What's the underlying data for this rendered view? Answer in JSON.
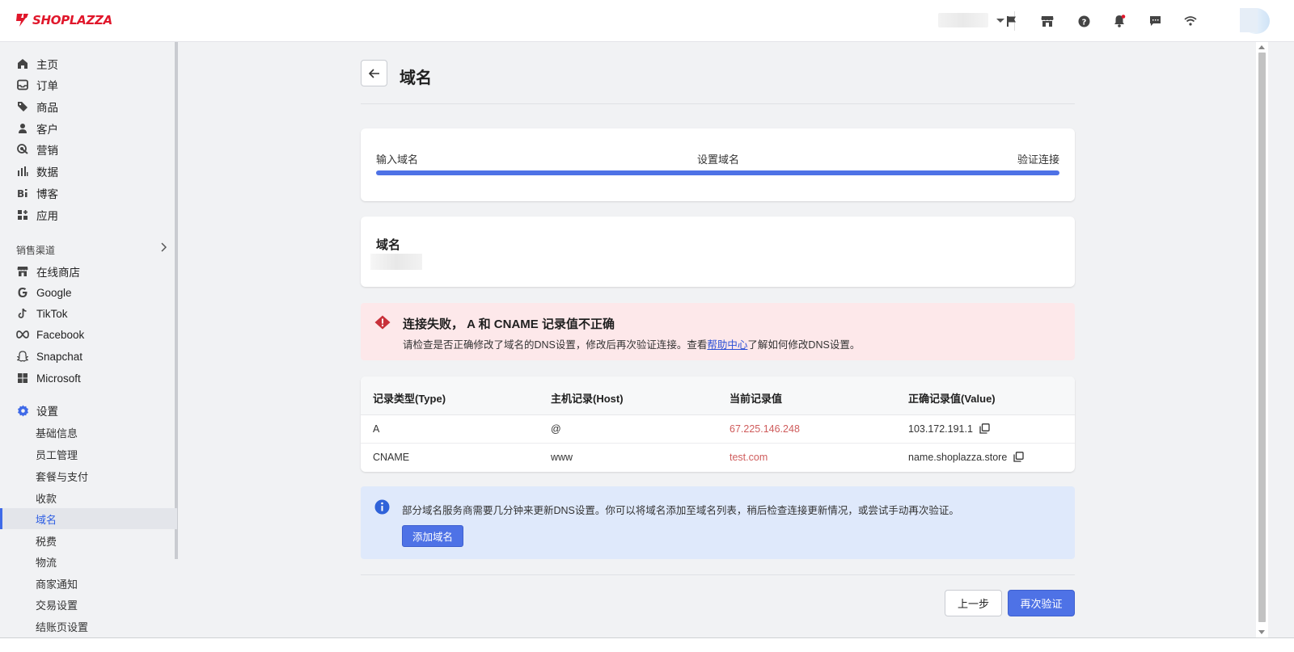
{
  "brand": {
    "name": "SHOPLAZZA",
    "color": "#e0172b",
    "accent": "#4e72e6"
  },
  "header": {
    "icons": [
      "flag-icon",
      "store-icon",
      "help-icon",
      "bell-icon",
      "message-icon",
      "wifi-icon"
    ]
  },
  "sidebar": {
    "main_items": [
      {
        "label": "主页",
        "icon": "home-icon"
      },
      {
        "label": "订单",
        "icon": "inbox-icon"
      },
      {
        "label": "商品",
        "icon": "tag-icon"
      },
      {
        "label": "客户",
        "icon": "person-icon"
      },
      {
        "label": "营销",
        "icon": "marketing-icon"
      },
      {
        "label": "数据",
        "icon": "bar-chart-icon"
      },
      {
        "label": "博客",
        "icon": "blog-icon"
      },
      {
        "label": "应用",
        "icon": "apps-icon"
      }
    ],
    "channels_title": "销售渠道",
    "channels": [
      {
        "label": "在线商店",
        "icon": "store-icon"
      },
      {
        "label": "Google",
        "icon": "google-icon"
      },
      {
        "label": "TikTok",
        "icon": "tiktok-icon"
      },
      {
        "label": "Facebook",
        "icon": "meta-icon"
      },
      {
        "label": "Snapchat",
        "icon": "snapchat-icon"
      },
      {
        "label": "Microsoft",
        "icon": "microsoft-icon"
      }
    ],
    "settings": {
      "label": "设置",
      "icon": "gear-icon",
      "items": [
        "基础信息",
        "员工管理",
        "套餐与支付",
        "收款",
        "域名",
        "税费",
        "物流",
        "商家通知",
        "交易设置",
        "结账页设置"
      ],
      "active": "域名"
    }
  },
  "page": {
    "title": "域名",
    "steps": [
      "输入域名",
      "设置域名",
      "验证连接"
    ],
    "progress": 1.0,
    "domain_card_title": "域名",
    "error": {
      "title": "连接失败， A 和 CNAME 记录值不正确",
      "body_before": "请检查是否正确修改了域名的DNS设置，修改后再次验证连接。查看",
      "link": "帮助中心",
      "body_after": "了解如何修改DNS设置。"
    },
    "table": {
      "headers": [
        "记录类型(Type)",
        "主机记录(Host)",
        "当前记录值",
        "正确记录值(Value)"
      ],
      "rows": [
        {
          "type": "A",
          "host": "@",
          "current": "67.225.146.248",
          "correct": "103.172.191.1"
        },
        {
          "type": "CNAME",
          "host": "www",
          "current": "test.com",
          "correct": "name.shoplazza.store"
        }
      ]
    },
    "info": {
      "text": "部分域名服务商需要几分钟来更新DNS设置。你可以将域名添加至域名列表，稍后检查连接更新情况，或尝试手动再次验证。",
      "button": "添加域名"
    },
    "footer": {
      "prev": "上一步",
      "verify": "再次验证"
    }
  }
}
